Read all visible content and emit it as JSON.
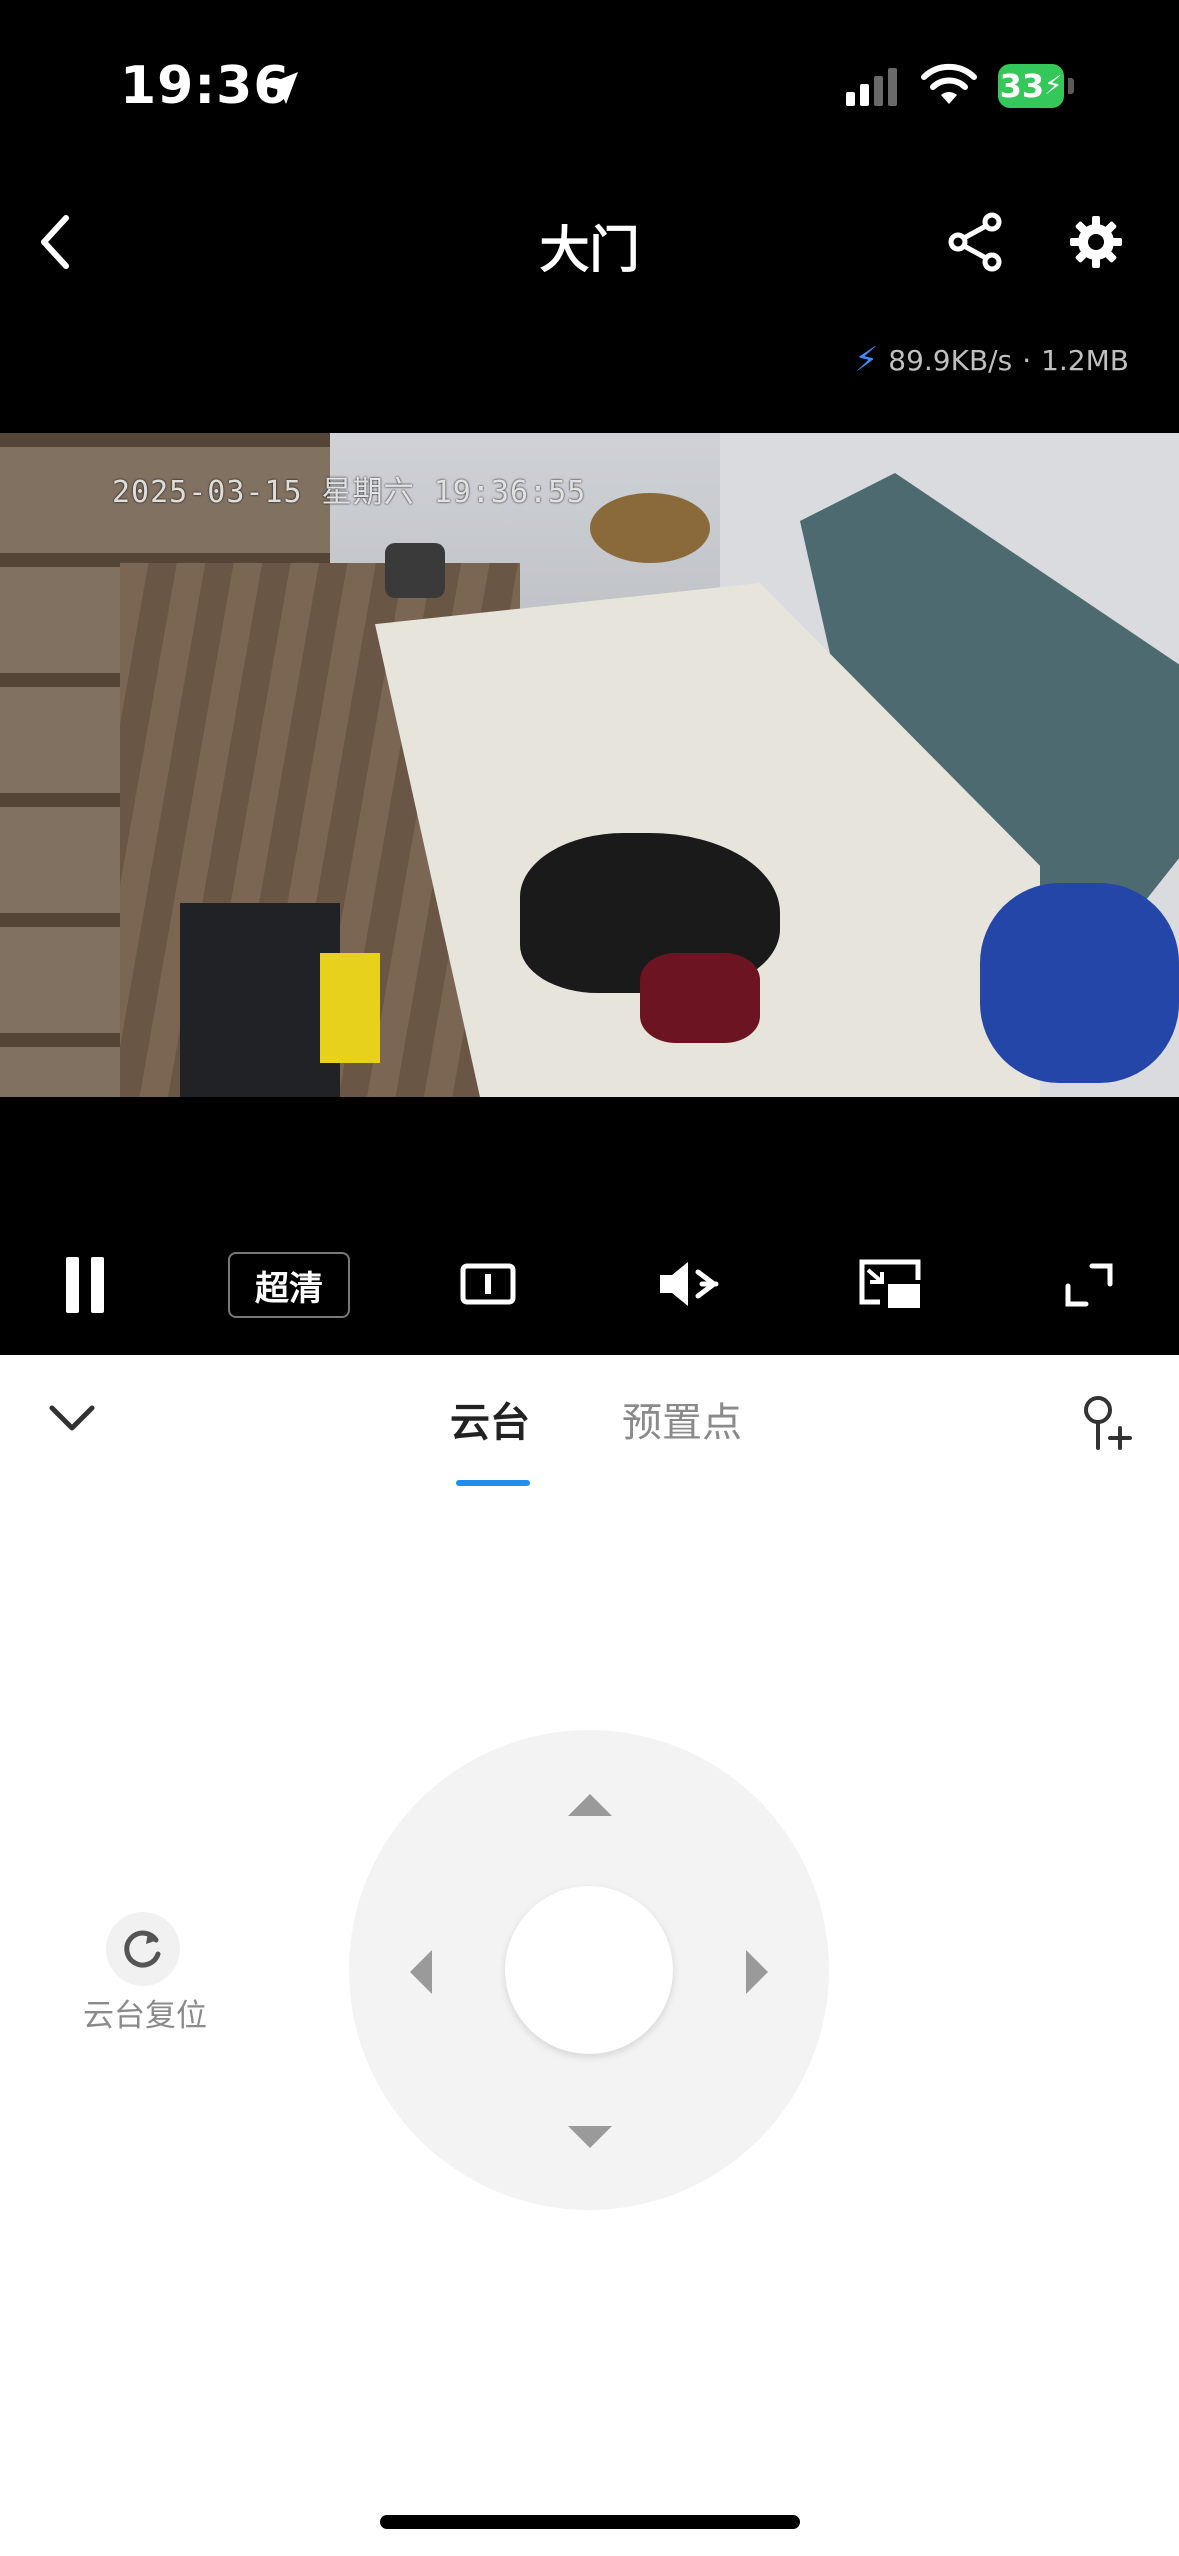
{
  "status_bar": {
    "time": "19:36",
    "battery": "33"
  },
  "header": {
    "title": "大门",
    "back_icon": "chevron-left-icon",
    "share_icon": "share-icon",
    "settings_icon": "gear-icon"
  },
  "stream": {
    "speed": "89.9KB/s",
    "separator": "·",
    "data_used": "1.2MB"
  },
  "video": {
    "osd_timestamp": "2025-03-15 星期六 19:36:55"
  },
  "controls": {
    "pause_icon": "pause-icon",
    "quality_label": "超清",
    "ratio_icon": "aspect-ratio-icon",
    "mute_icon": "speaker-muted-icon",
    "pip_icon": "picture-in-picture-icon",
    "fullscreen_icon": "fullscreen-icon"
  },
  "panel": {
    "collapse_icon": "chevron-down-icon",
    "tabs": [
      {
        "label": "云台",
        "active": true
      },
      {
        "label": "预置点",
        "active": false
      }
    ],
    "add_preset_icon": "add-location-icon",
    "reset_label": "云台复位"
  },
  "colors": {
    "accent": "#1f8ef1",
    "battery_green": "#34c759"
  }
}
